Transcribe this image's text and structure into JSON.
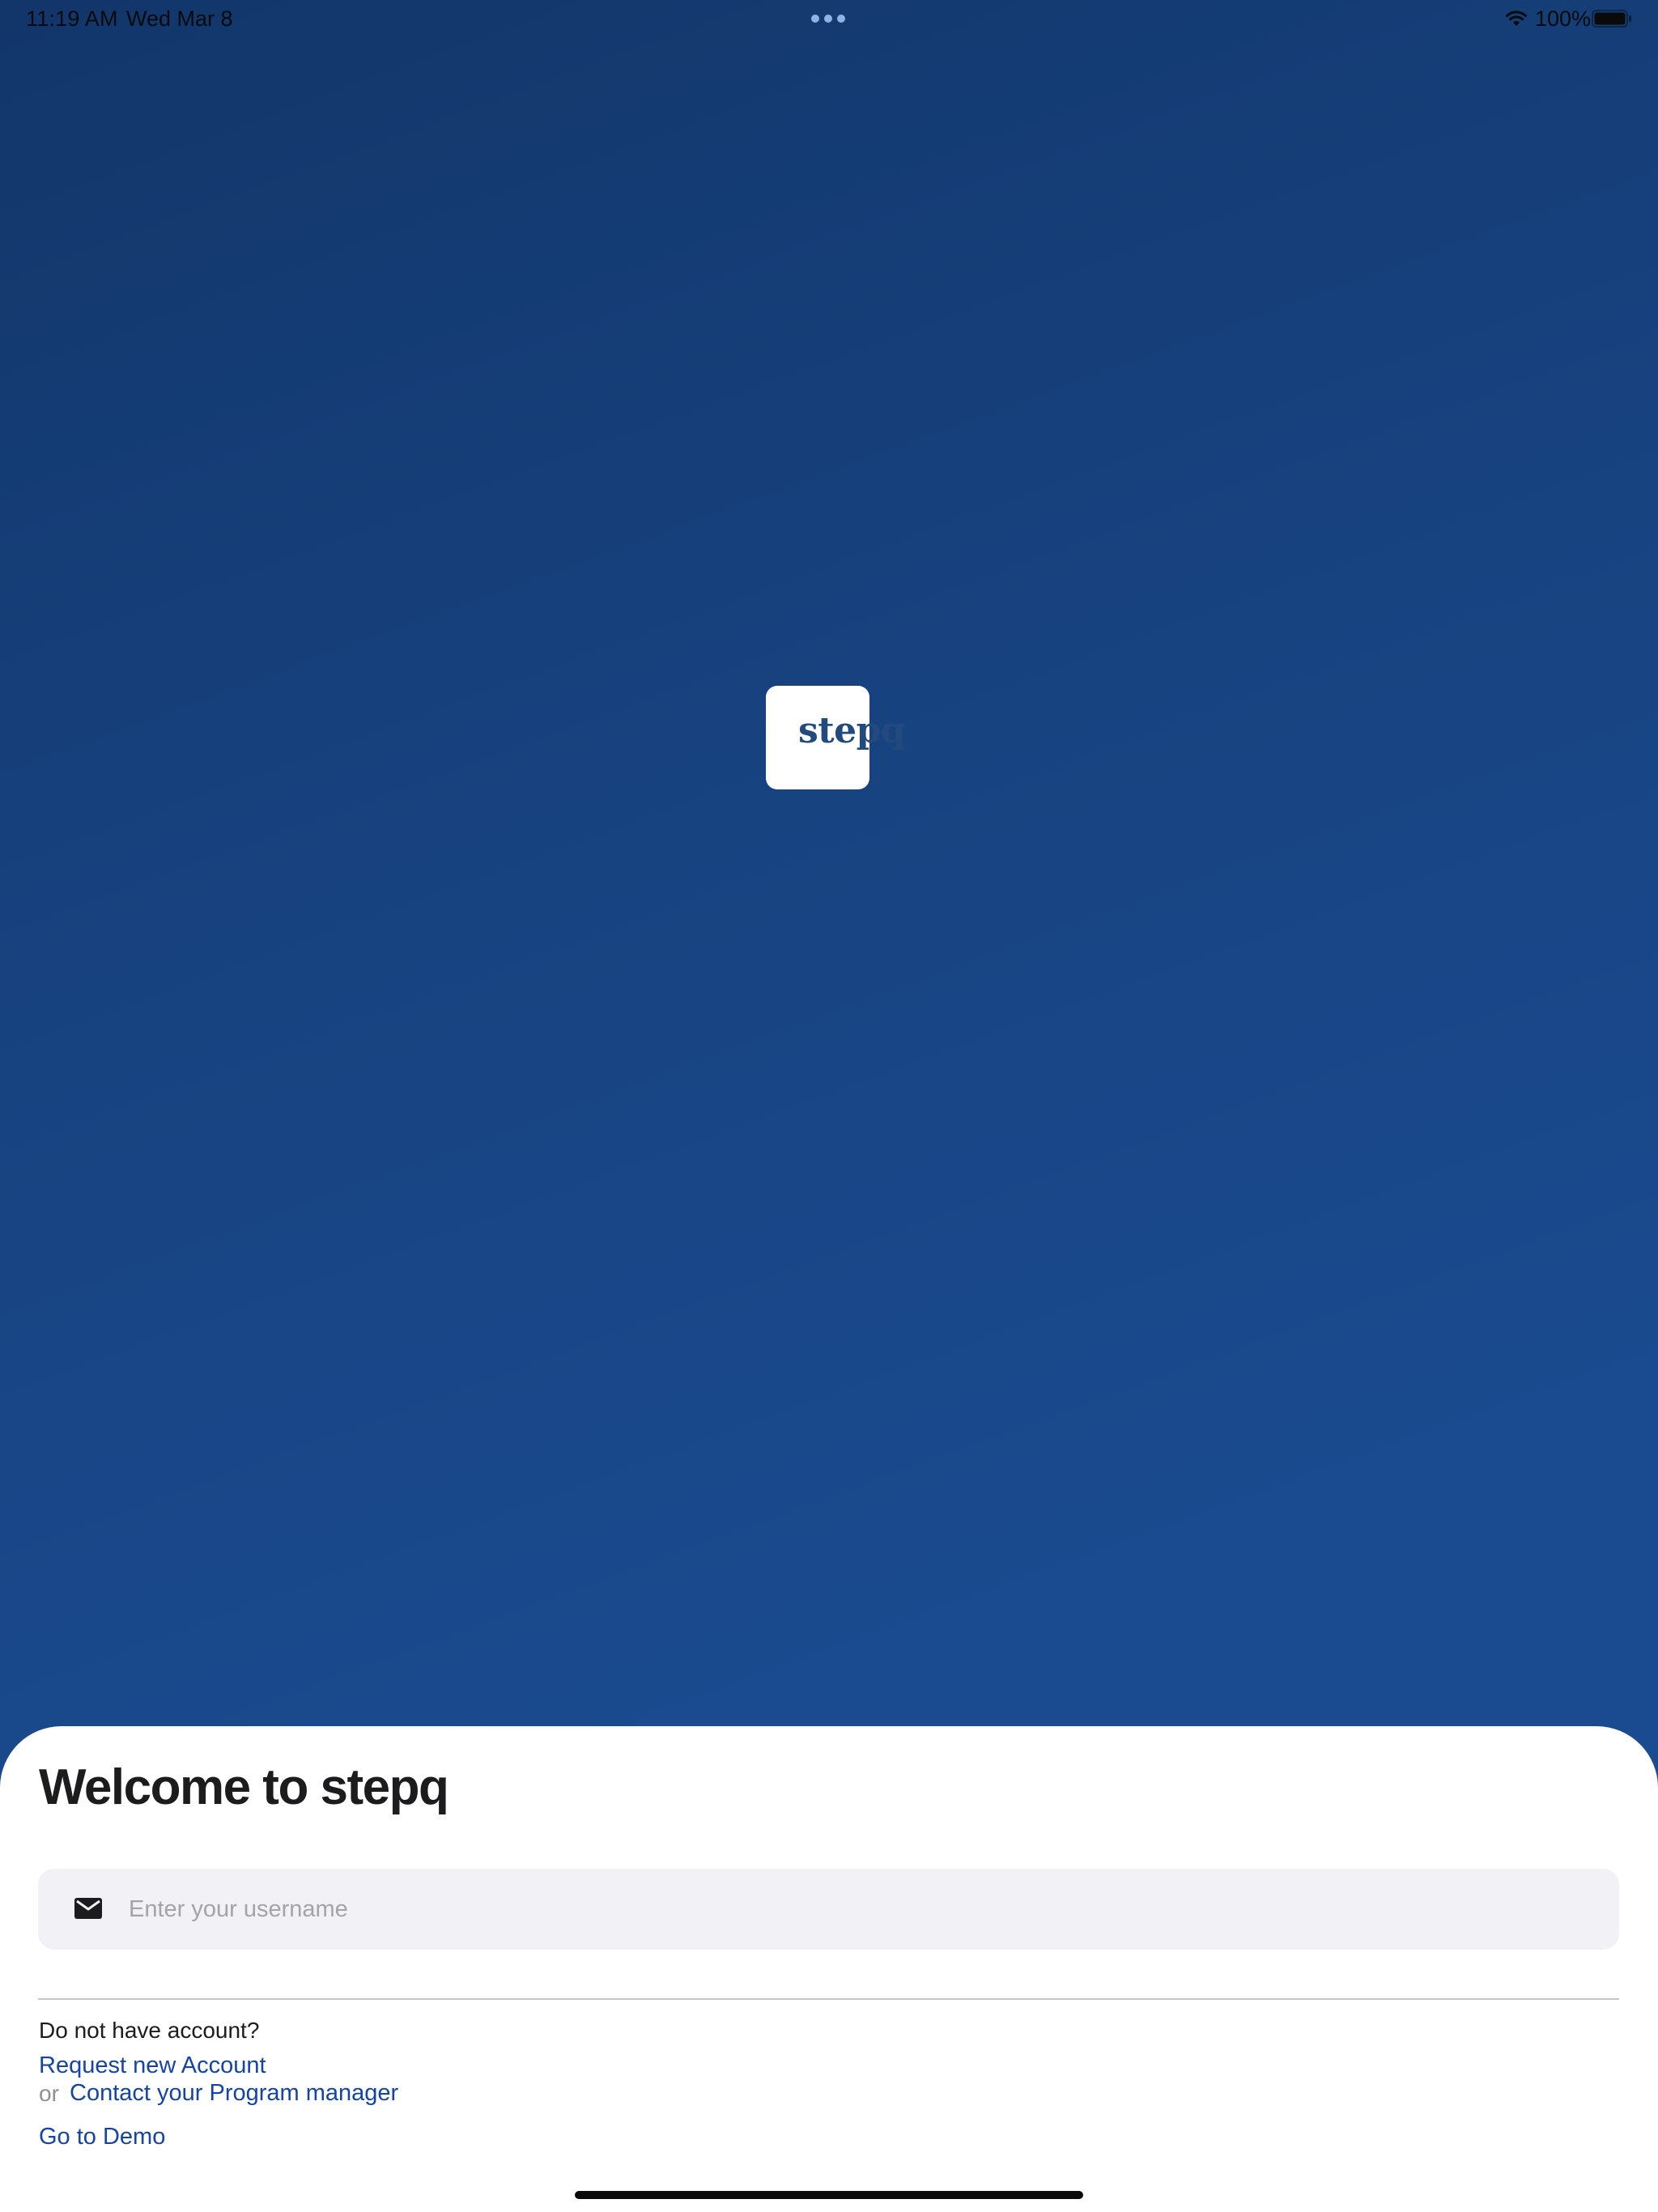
{
  "status_bar": {
    "time": "11:19 AM",
    "date": "Wed Mar 8",
    "battery": "100%"
  },
  "logo": {
    "text": "stepq"
  },
  "login": {
    "title": "Welcome to stepq",
    "username_placeholder": "Enter your username",
    "username_value": "",
    "no_account_text": "Do not have account?",
    "request_account_label": "Request new Account",
    "or_text": "or",
    "contact_manager_label": "Contact your Program manager",
    "demo_label": "Go to Demo"
  },
  "colors": {
    "background_top": "#12366a",
    "background_bottom": "#1b4d94",
    "link": "#1544a6",
    "logo_text": "#234a7c",
    "input_background": "#f2f2f6"
  },
  "icons": {
    "status_wifi": "wifi-icon",
    "status_battery": "battery-icon",
    "input_leading": "mail-icon"
  }
}
